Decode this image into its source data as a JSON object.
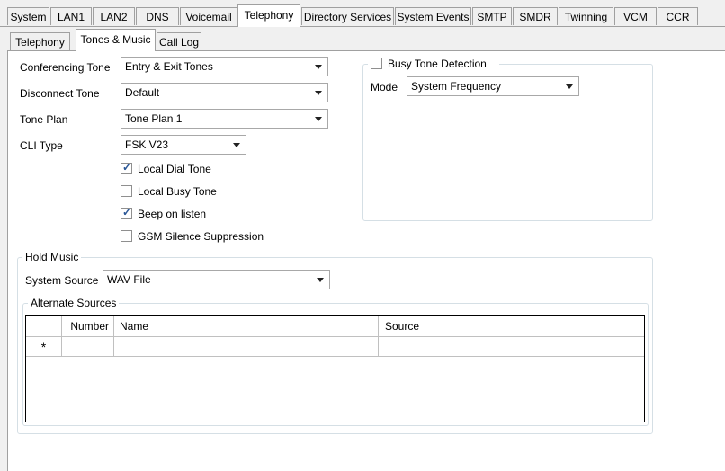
{
  "tabs": [
    "System",
    "LAN1",
    "LAN2",
    "DNS",
    "Voicemail",
    "Telephony",
    "Directory Services",
    "System Events",
    "SMTP",
    "SMDR",
    "Twinning",
    "VCM",
    "CCR"
  ],
  "active_tab": "Telephony",
  "subtabs": [
    "Telephony",
    "Tones & Music",
    "Call Log"
  ],
  "active_subtab": "Tones & Music",
  "fields": {
    "conferencing_tone": {
      "label": "Conferencing Tone",
      "value": "Entry & Exit Tones"
    },
    "disconnect_tone": {
      "label": "Disconnect Tone",
      "value": "Default"
    },
    "tone_plan": {
      "label": "Tone Plan",
      "value": "Tone Plan 1"
    },
    "cli_type": {
      "label": "CLI Type",
      "value": "FSK V23"
    }
  },
  "checkboxes": {
    "local_dial_tone": {
      "label": "Local Dial Tone",
      "checked": true
    },
    "local_busy_tone": {
      "label": "Local Busy Tone",
      "checked": false
    },
    "beep_on_listen": {
      "label": "Beep on listen",
      "checked": true
    },
    "gsm_silence": {
      "label": "GSM Silence Suppression",
      "checked": false
    }
  },
  "busy_tone": {
    "title": "Busy Tone Detection",
    "checked": false,
    "mode_label": "Mode",
    "mode_value": "System Frequency"
  },
  "hold_music": {
    "title": "Hold Music",
    "source_label": "System Source",
    "source_value": "WAV File",
    "alternate_title": "Alternate Sources",
    "columns": [
      "Number",
      "Name",
      "Source"
    ],
    "new_row_marker": "*"
  },
  "check_glyph": "✓"
}
